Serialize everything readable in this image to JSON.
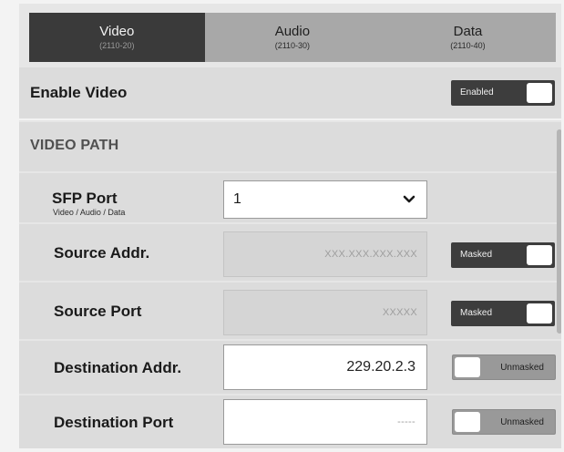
{
  "tabs": [
    {
      "label": "Video",
      "sub": "(2110-20)",
      "active": true
    },
    {
      "label": "Audio",
      "sub": "(2110-30)",
      "active": false
    },
    {
      "label": "Data",
      "sub": "(2110-40)",
      "active": false
    }
  ],
  "enable_video": {
    "label": "Enable Video",
    "toggle": "Enabled"
  },
  "section": {
    "title": "VIDEO PATH"
  },
  "sfp_port": {
    "label": "SFP Port",
    "sublabel": "Video / Audio / Data",
    "value": "1"
  },
  "source_addr": {
    "label": "Source Addr.",
    "placeholder": "XXX.XXX.XXX.XXX",
    "toggle": "Masked"
  },
  "source_port": {
    "label": "Source Port",
    "placeholder": "XXXXX",
    "toggle": "Masked"
  },
  "dest_addr": {
    "label": "Destination Addr.",
    "value": "229.20.2.3",
    "toggle": "Unmasked"
  },
  "dest_port": {
    "label": "Destination Port",
    "placeholder": "-----",
    "toggle": "Unmasked"
  }
}
